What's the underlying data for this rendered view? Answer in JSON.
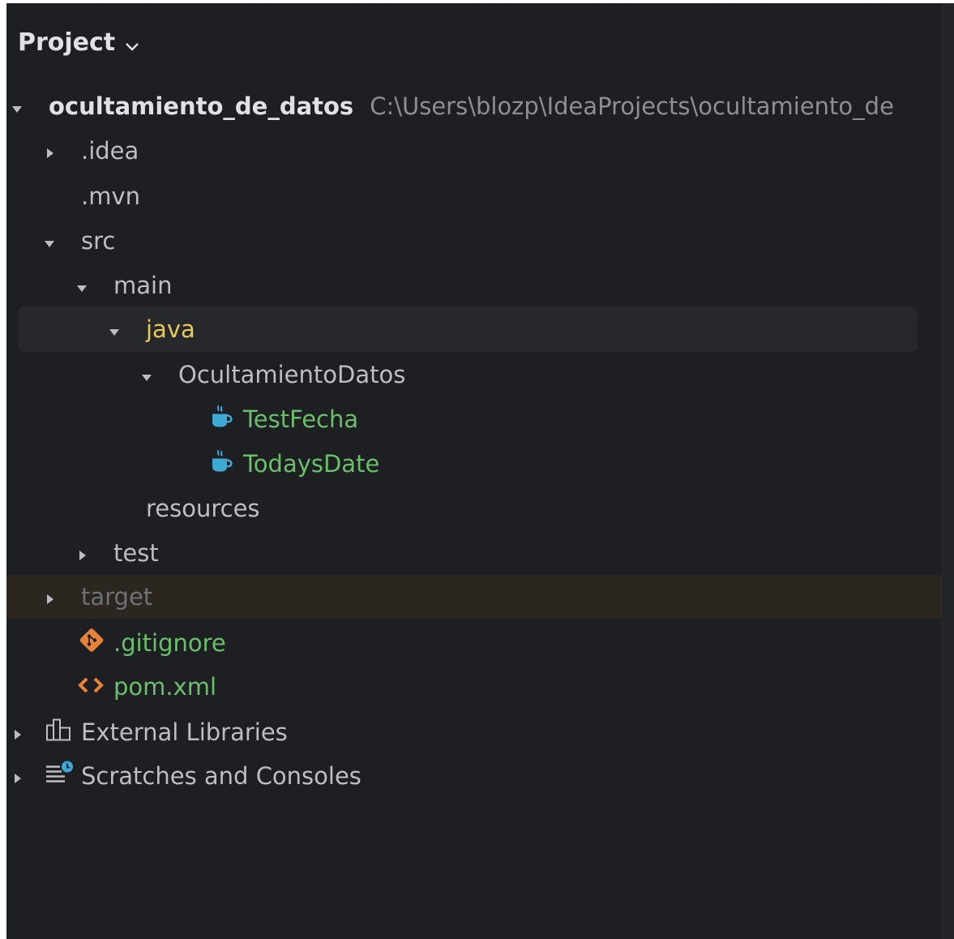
{
  "panel": {
    "title": "Project"
  },
  "tree": {
    "root": {
      "name": "ocultamiento_de_datos",
      "path": "C:\\Users\\blozp\\IdeaProjects\\ocultamiento_de"
    },
    "idea": ".idea",
    "mvn": ".mvn",
    "src": "src",
    "main": "main",
    "java": "java",
    "package": "OcultamientoDatos",
    "class1": "TestFecha",
    "class2": "TodaysDate",
    "resources": "resources",
    "test": "test",
    "target": "target",
    "gitignore": ".gitignore",
    "pom": "pom.xml",
    "external_libraries": "External Libraries",
    "scratches": "Scratches and Consoles"
  },
  "colors": {
    "background": "#1e1f22",
    "text": "#bcbec4",
    "java_folder": "#e8c95d",
    "vcs_added": "#6abf6a",
    "excluded": "#6f7177",
    "java_icon": "#3fa9d6",
    "git_icon": "#e8823a",
    "xml_icon": "#e8823a"
  },
  "icons": {
    "class_icon": "java-class-icon",
    "git_icon": "git-icon",
    "xml_icon": "xml-icon",
    "libraries_icon": "libraries-icon",
    "scratches_icon": "scratches-icon"
  }
}
